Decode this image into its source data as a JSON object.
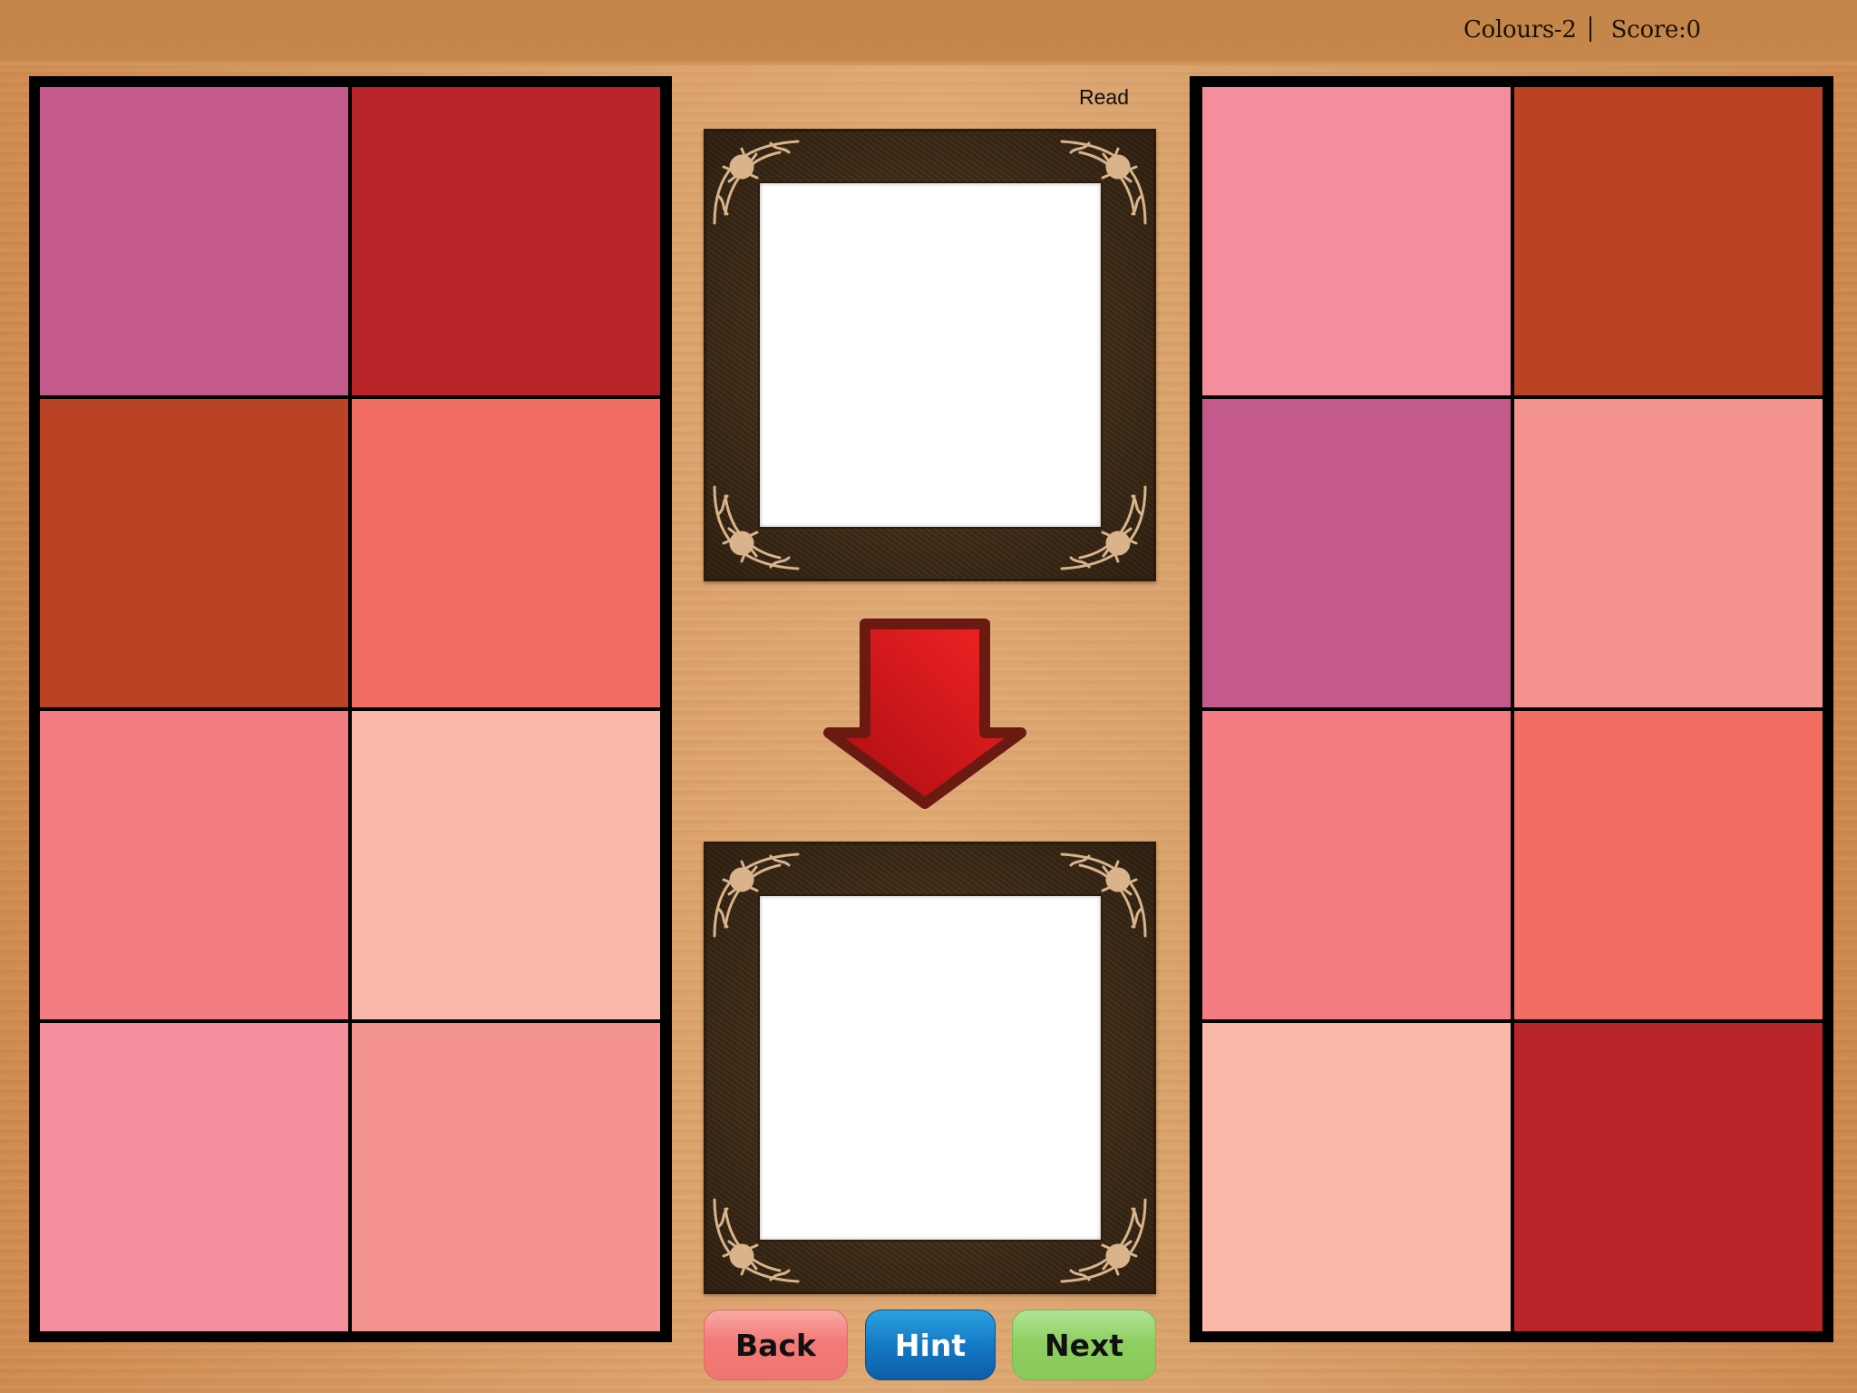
{
  "header": {
    "level_label": "Colours-2",
    "score_label": "Score:0"
  },
  "mode_label": "Read",
  "palette": {
    "magenta": "#c45a8c",
    "crimson": "#b82428",
    "rust": "#b94324",
    "coral": "#f26e62",
    "salmon_pink": "#f37c83",
    "peach": "#f9b8a8",
    "rose_pink": "#f48d9c",
    "light_salmon": "#f4928d"
  },
  "left_grid": {
    "cells": [
      {
        "color": "#c45a8c",
        "name": "magenta"
      },
      {
        "color": "#b82428",
        "name": "crimson"
      },
      {
        "color": "#b94324",
        "name": "rust"
      },
      {
        "color": "#f26e62",
        "name": "coral"
      },
      {
        "color": "#f37c83",
        "name": "salmon-pink"
      },
      {
        "color": "#f9b8a8",
        "name": "peach"
      },
      {
        "color": "#f48d9c",
        "name": "rose-pink"
      },
      {
        "color": "#f4928d",
        "name": "light-salmon"
      }
    ]
  },
  "right_grid": {
    "cells": [
      {
        "color": "#f48d9c",
        "name": "rose-pink"
      },
      {
        "color": "#b94324",
        "name": "rust"
      },
      {
        "color": "#c45a8c",
        "name": "magenta"
      },
      {
        "color": "#f4928d",
        "name": "light-salmon"
      },
      {
        "color": "#f37c83",
        "name": "salmon-pink"
      },
      {
        "color": "#f26e62",
        "name": "coral"
      },
      {
        "color": "#f9b8a8",
        "name": "peach"
      },
      {
        "color": "#b82428",
        "name": "crimson"
      }
    ]
  },
  "frames": {
    "top_icon": "ornate-picture-frame",
    "bottom_icon": "ornate-picture-frame",
    "arrow_icon": "arrow-down",
    "arrow_color": "#d61c20"
  },
  "buttons": {
    "back": "Back",
    "hint": "Hint",
    "next": "Next"
  }
}
